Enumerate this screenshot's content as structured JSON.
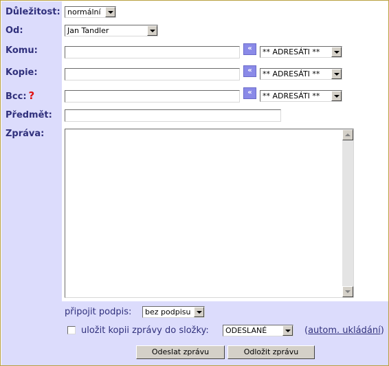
{
  "form": {
    "importance": {
      "label": "Důležitost:",
      "value": "normální"
    },
    "from": {
      "label": "Od:",
      "value": "Jan Tandler"
    },
    "to": {
      "label": "Komu:",
      "value": "",
      "recipients_select": "** ADRESÁTI **"
    },
    "cc": {
      "label": "Kopie:",
      "value": "",
      "recipients_select": "** ADRESÁTI **"
    },
    "bcc": {
      "label": "Bcc:",
      "help_mark": "?",
      "value": "",
      "recipients_select": "** ADRESÁTI **"
    },
    "subject": {
      "label": "Předmět:",
      "value": ""
    },
    "message": {
      "label": "Zpráva:",
      "value": ""
    }
  },
  "options": {
    "signature_label": "připojit podpis:",
    "signature_value": "bez podpisu",
    "save_copy_label": "uložit kopii zprávy do složky:",
    "save_copy_checked": false,
    "folder_value": "ODESLANÉ",
    "autosave_open": "(",
    "autosave_link": "autom. ukládání",
    "autosave_close": ")"
  },
  "buttons": {
    "send": "Odeslat zprávu",
    "postpone": "Odložit zprávu"
  },
  "icons": {
    "add_recipient": "double-left-arrow-icon",
    "scroll_up": "arrow-up-icon",
    "scroll_down": "arrow-down-icon"
  },
  "colors": {
    "label_bg": "#dcdcfc",
    "label_text": "#30307c",
    "border": "#b8a040",
    "help_mark": "#e01010",
    "pick_button": "#8a8ae8"
  }
}
